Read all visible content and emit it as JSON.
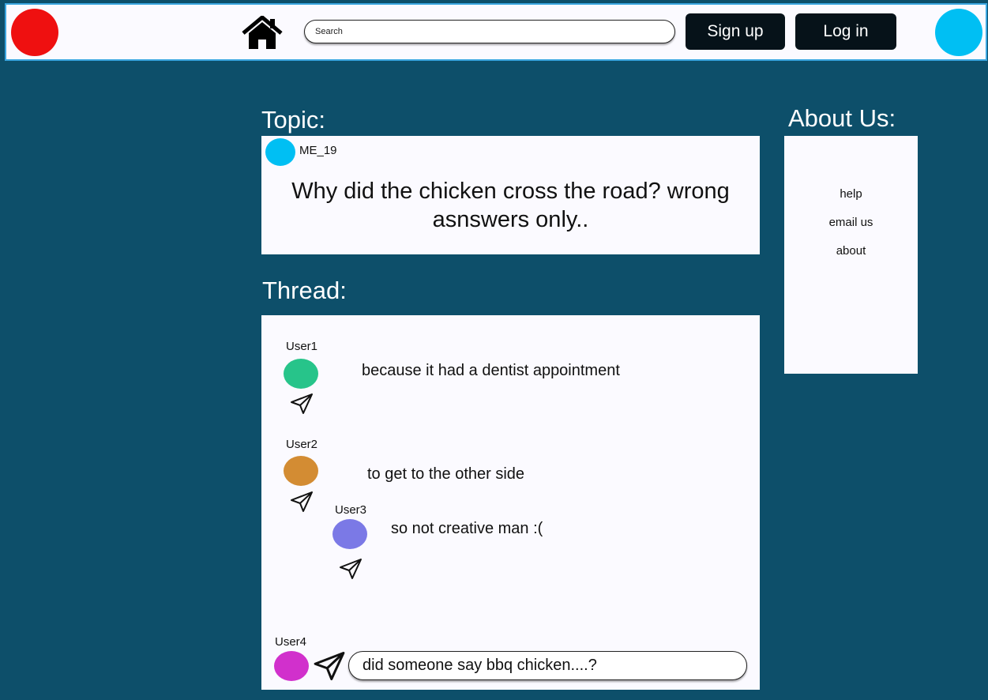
{
  "header": {
    "search_placeholder": "Search",
    "signup_label": "Sign up",
    "login_label": "Log in",
    "logo_color": "#ef1010",
    "avatar_color": "#00bff3",
    "home_icon": "home-icon"
  },
  "topic": {
    "heading": "Topic:",
    "author": "ME_19",
    "author_avatar_color": "#00bff3",
    "question": "Why did the chicken cross the road? wrong asnswers only.."
  },
  "thread": {
    "heading": "Thread:",
    "posts": [
      {
        "user": "User1",
        "avatar_color": "#27c48a",
        "text": "because it had a dentist appointment"
      },
      {
        "user": "User2",
        "avatar_color": "#d38c33",
        "text": "to get to the other side"
      },
      {
        "user": "User3",
        "avatar_color": "#7b79e6",
        "text": "so not creative man :("
      }
    ],
    "reply": {
      "user": "User4",
      "avatar_color": "#d130cc",
      "value": "did someone say bbq chicken....?"
    },
    "send_icon": "send-icon"
  },
  "about": {
    "heading": "About Us:",
    "links": [
      "help",
      "email us",
      "about"
    ]
  },
  "colors": {
    "background": "#0d4f6a",
    "panel": "#fbfaff",
    "button_dark": "#061219",
    "header_border": "#3aa6e0"
  }
}
